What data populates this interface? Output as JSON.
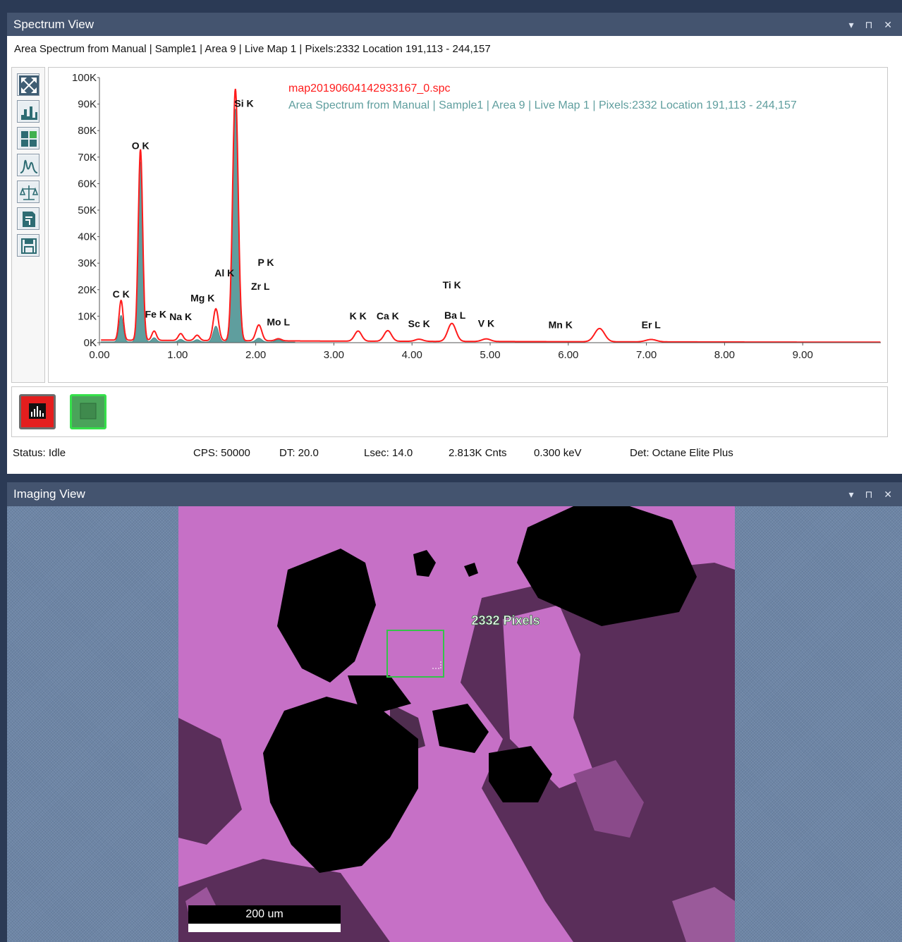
{
  "spectrum_panel": {
    "title": "Spectrum View",
    "controls": "▾ ⊓ ✕",
    "subtitle": "Area Spectrum from Manual | Sample1 | Area 9 | Live Map 1 |  Pixels:2332 Location 191,113 - 244,157",
    "toolbar": [
      {
        "icon": "zoom-fit-icon"
      },
      {
        "icon": "spectrum-scale-icon"
      },
      {
        "icon": "layout-grid-icon"
      },
      {
        "icon": "peak-fit-icon"
      },
      {
        "icon": "balance-icon"
      },
      {
        "icon": "export-icon"
      },
      {
        "icon": "save-icon"
      }
    ],
    "status": {
      "state": "Status: Idle",
      "cps": "CPS: 50000",
      "dt": "DT: 20.0",
      "lsec": "Lsec: 14.0",
      "cnts": "2.813K Cnts",
      "kev": "0.300 keV",
      "det": "Det: Octane Elite Plus"
    }
  },
  "imaging_panel": {
    "title": "Imaging View",
    "controls": "▾ ⊓ ✕",
    "roi_label": "2332 Pixels",
    "scale_label": "200 um"
  },
  "colors": {
    "red_spectrum": "#ff1c1c",
    "area_spectrum": "#5f9e9e",
    "map_phase": "#c670c6",
    "roi": "#35c24a"
  },
  "chart_data": {
    "type": "line",
    "title": "",
    "xlabel": "",
    "ylabel": "",
    "xlim": [
      0,
      10
    ],
    "ylim": [
      0,
      100000
    ],
    "x_ticks": [
      "0.00",
      "1.00",
      "2.00",
      "3.00",
      "4.00",
      "5.00",
      "6.00",
      "7.00",
      "8.00",
      "9.00"
    ],
    "y_ticks": [
      "0K",
      "10K",
      "20K",
      "30K",
      "40K",
      "50K",
      "60K",
      "70K",
      "80K",
      "90K",
      "100K"
    ],
    "grid": false,
    "legend": [
      {
        "label": "map20190604142933167_0.spc",
        "color": "#ff1c1c"
      },
      {
        "label": "Area Spectrum from Manual | Sample1 | Area 9 | Live Map 1 |  Pixels:2332 Location 191,113 - 244,157",
        "color": "#5f9e9e"
      }
    ],
    "series": [
      {
        "name": "map20190604142933167_0.spc",
        "kind": "line",
        "background": 1000,
        "peaks": [
          [
            0.277,
            15000
          ],
          [
            0.525,
            72000
          ],
          [
            0.7,
            3500
          ],
          [
            1.04,
            2600
          ],
          [
            1.25,
            2000
          ],
          [
            1.49,
            12000
          ],
          [
            1.74,
            95000
          ],
          [
            2.04,
            6000
          ],
          [
            2.29,
            800
          ],
          [
            3.31,
            3800
          ],
          [
            3.69,
            4000
          ],
          [
            4.09,
            800
          ],
          [
            4.51,
            6800
          ],
          [
            4.95,
            1000
          ],
          [
            6.4,
            5000
          ],
          [
            7.06,
            900
          ]
        ]
      },
      {
        "name": "Area Spectrum from Manual | Sample1 | Area 9 | Live Map 1 |  Pixels:2332 Location 191,113 - 244,157",
        "kind": "area",
        "background": 300,
        "peaks": [
          [
            0.277,
            10000
          ],
          [
            0.525,
            68000
          ],
          [
            0.7,
            1600
          ],
          [
            1.04,
            1000
          ],
          [
            1.25,
            900
          ],
          [
            1.49,
            6000
          ],
          [
            1.74,
            88000
          ],
          [
            2.04,
            1500
          ],
          [
            2.29,
            900
          ]
        ]
      }
    ],
    "annotations": [
      {
        "text": "C  K",
        "x": 0.277,
        "y": 17000
      },
      {
        "text": "O  K",
        "x": 0.525,
        "y": 73000
      },
      {
        "text": "Fe K",
        "x": 0.72,
        "y": 9500
      },
      {
        "text": "Na K",
        "x": 1.04,
        "y": 8500
      },
      {
        "text": "Mg K",
        "x": 1.32,
        "y": 15500
      },
      {
        "text": "Al K",
        "x": 1.6,
        "y": 25000
      },
      {
        "text": "Si K",
        "x": 1.85,
        "y": 89000
      },
      {
        "text": "P  K",
        "x": 2.13,
        "y": 29000
      },
      {
        "text": "Zr L",
        "x": 2.06,
        "y": 20000
      },
      {
        "text": "Mo L",
        "x": 2.29,
        "y": 6500
      },
      {
        "text": "K  K",
        "x": 3.31,
        "y": 8800
      },
      {
        "text": "Ca K",
        "x": 3.69,
        "y": 8800
      },
      {
        "text": "Sc K",
        "x": 4.09,
        "y": 5800
      },
      {
        "text": "Ti K",
        "x": 4.51,
        "y": 20500
      },
      {
        "text": "Ba L",
        "x": 4.55,
        "y": 9000
      },
      {
        "text": "V  K",
        "x": 4.95,
        "y": 6000
      },
      {
        "text": "Mn K",
        "x": 5.9,
        "y": 5500
      },
      {
        "text": "Er L",
        "x": 7.06,
        "y": 5500
      }
    ]
  }
}
